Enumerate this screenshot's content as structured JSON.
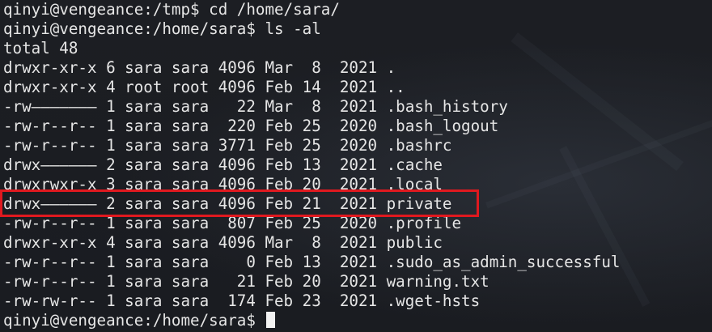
{
  "terminal": {
    "lines": [
      "qinyi@vengeance:/tmp$ cd /home/sara/",
      "qinyi@vengeance:/home/sara$ ls -al",
      "total 48",
      "drwxr-xr-x 6 sara sara 4096 Mar  8  2021 .",
      "drwxr-xr-x 4 root root 4096 Feb 14  2021 ..",
      "-rw——————— 1 sara sara   22 Mar  8  2021 .bash_history",
      "-rw-r--r-- 1 sara sara  220 Feb 25  2020 .bash_logout",
      "-rw-r--r-- 1 sara sara 3771 Feb 25  2020 .bashrc",
      "drwx—————— 2 sara sara 4096 Feb 13  2021 .cache",
      "drwxrwxr-x 3 sara sara 4096 Feb 20  2021 .local",
      "drwx—————— 2 sara sara 4096 Feb 21  2021 private",
      "-rw-r--r-- 1 sara sara  807 Feb 25  2020 .profile",
      "drwxr-xr-x 4 sara sara 4096 Mar  8  2021 public",
      "-rw-r--r-- 1 sara sara    0 Feb 13  2021 .sudo_as_admin_successful",
      "-rw-r--r-- 1 sara sara   21 Feb 20  2021 warning.txt",
      "-rw-rw-r-- 1 sara sara  174 Feb 23  2021 .wget-hsts"
    ],
    "prompt": "qinyi@vengeance:/home/sara$ ",
    "highlight_color": "#e0191f",
    "background_color": "#1b1d22",
    "text_color": "#e6e6e6"
  }
}
